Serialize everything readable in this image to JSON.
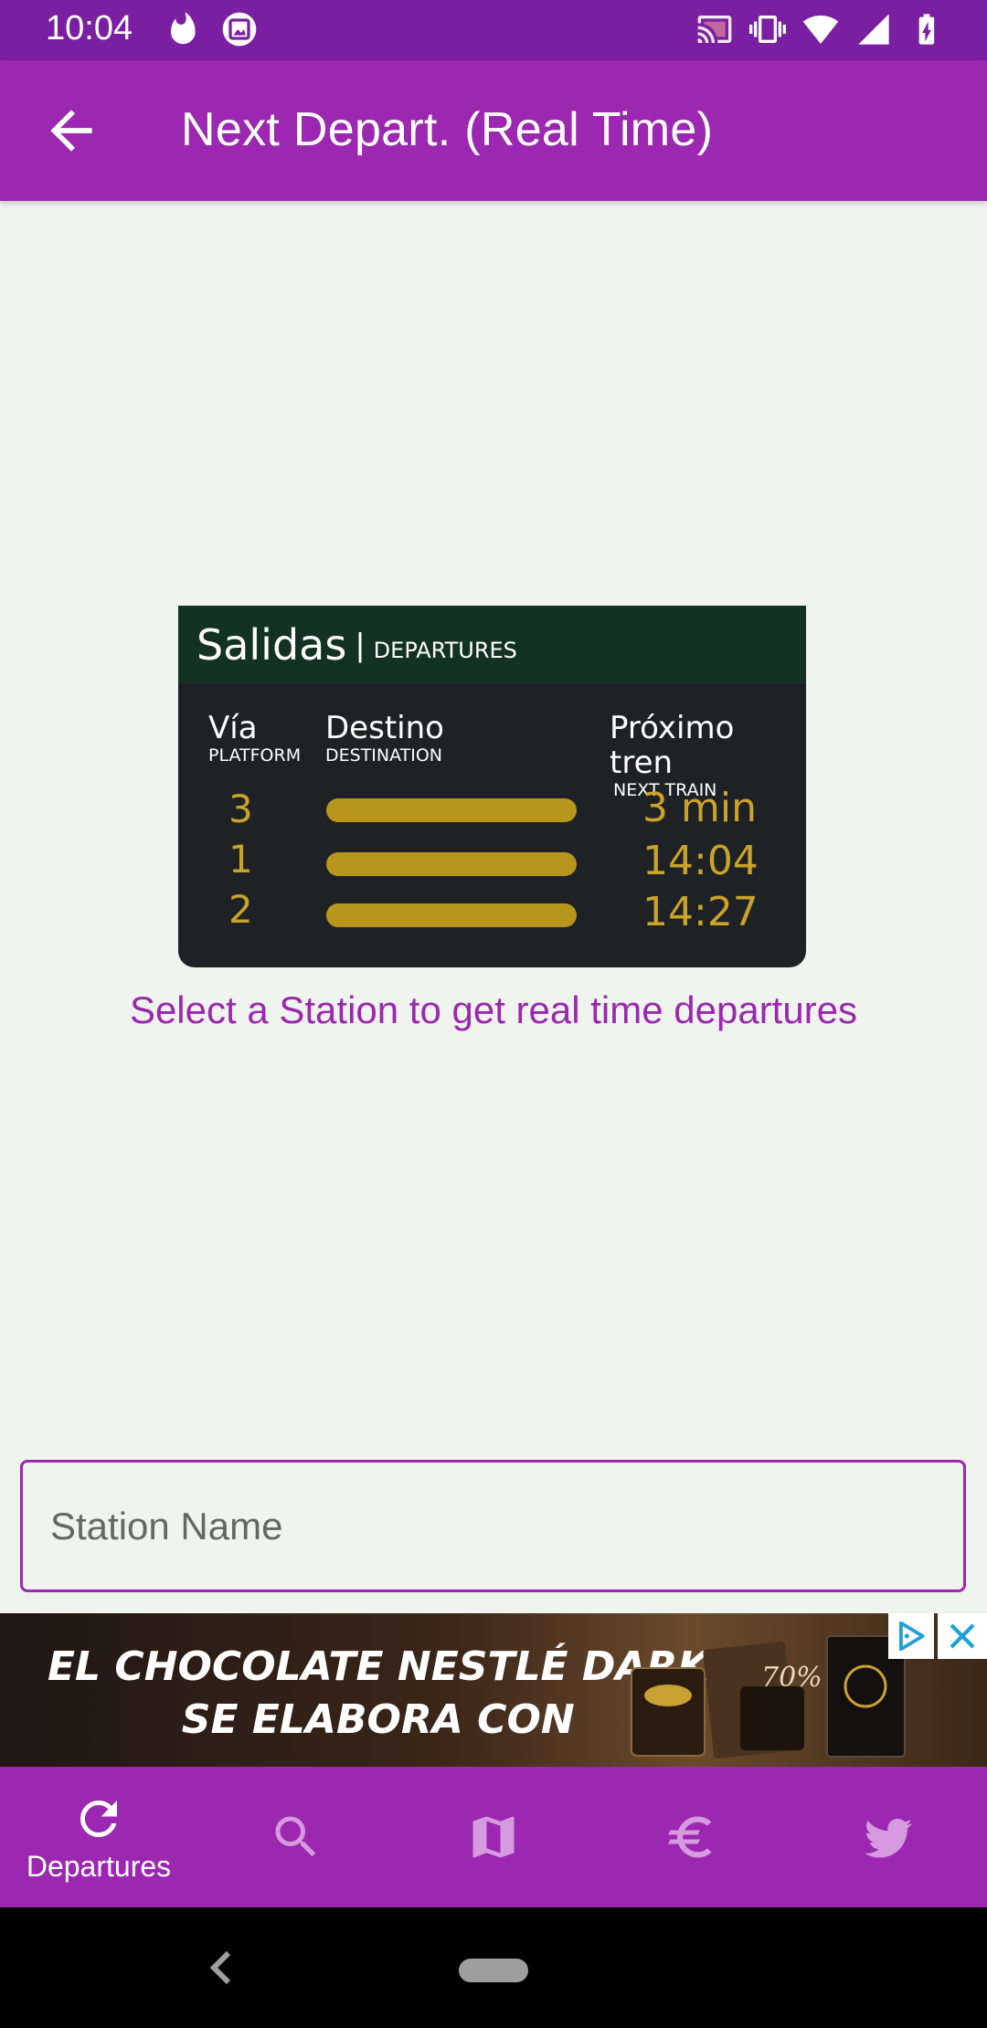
{
  "status_bar": {
    "time": "10:04"
  },
  "app_bar": {
    "title": "Next Depart. (Real Time)"
  },
  "board": {
    "title": "Salidas",
    "separator": "|",
    "subtitle": "DEPARTURES",
    "columns": [
      {
        "main": "Vía",
        "sub": "PLATFORM"
      },
      {
        "main": "Destino",
        "sub": "DESTINATION"
      },
      {
        "main": "Próximo tren",
        "sub": "NEXT TRAIN"
      }
    ],
    "rows": [
      {
        "platform": "3",
        "next": "3 min"
      },
      {
        "platform": "1",
        "next": "14:04"
      },
      {
        "platform": "2",
        "next": "14:27"
      }
    ]
  },
  "prompt": "Select a Station to get real time departures",
  "station_input": {
    "placeholder": "Station Name",
    "value": ""
  },
  "ad": {
    "line1": "EL CHOCOLATE NESTLÉ DARK",
    "line2": "SE ELABORA CON",
    "product_badge": "70%"
  },
  "bottom_nav": {
    "items": [
      {
        "label": "Departures",
        "icon": "refresh-icon",
        "active": true
      },
      {
        "label": "",
        "icon": "search-icon",
        "active": false
      },
      {
        "label": "",
        "icon": "map-icon",
        "active": false
      },
      {
        "label": "",
        "icon": "euro-icon",
        "active": false
      },
      {
        "label": "",
        "icon": "twitter-icon",
        "active": false
      }
    ]
  },
  "colors": {
    "primary": "#9c27b0",
    "primary_dark": "#7b1fa2",
    "background": "#eff5ee",
    "board_gold": "#c9a32a"
  }
}
